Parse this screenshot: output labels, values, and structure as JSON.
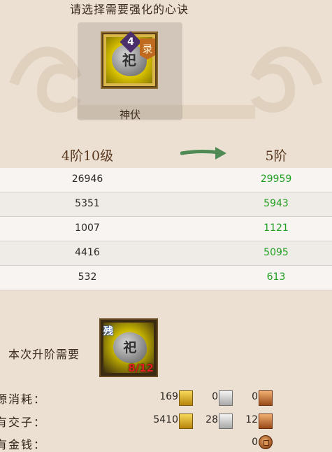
{
  "header": {
    "title": "请选择需要强化的心诀"
  },
  "selected_item": {
    "name": "神伏",
    "tier_badge": "4",
    "seal_char": "录",
    "stone_glyph": "祀",
    "icon": "rune-stone-icon"
  },
  "upgrade": {
    "current_stage": "4阶10级",
    "next_stage": "5阶",
    "arrow_color": "#4f8a55"
  },
  "stats": [
    {
      "current": "26946",
      "next": "29959"
    },
    {
      "current": "5351",
      "next": "5943"
    },
    {
      "current": "1007",
      "next": "1121"
    },
    {
      "current": "4416",
      "next": "5095"
    },
    {
      "current": "532",
      "next": "613"
    }
  ],
  "requirement": {
    "label": "本次升阶需要",
    "item_tag": "残",
    "stone_glyph": "祀",
    "count": "8/12"
  },
  "costs": {
    "resource": {
      "label": "源消耗：",
      "gold": "169",
      "silver": "0",
      "copper": "0"
    },
    "jiaozi": {
      "label": "有交子：",
      "gold": "5410",
      "silver": "28",
      "copper": "12"
    },
    "money": {
      "label": "有金钱：",
      "coin": "0"
    }
  },
  "colors": {
    "background": "#ece0d2",
    "next_value": "#22a022",
    "required_count": "#e02020"
  }
}
